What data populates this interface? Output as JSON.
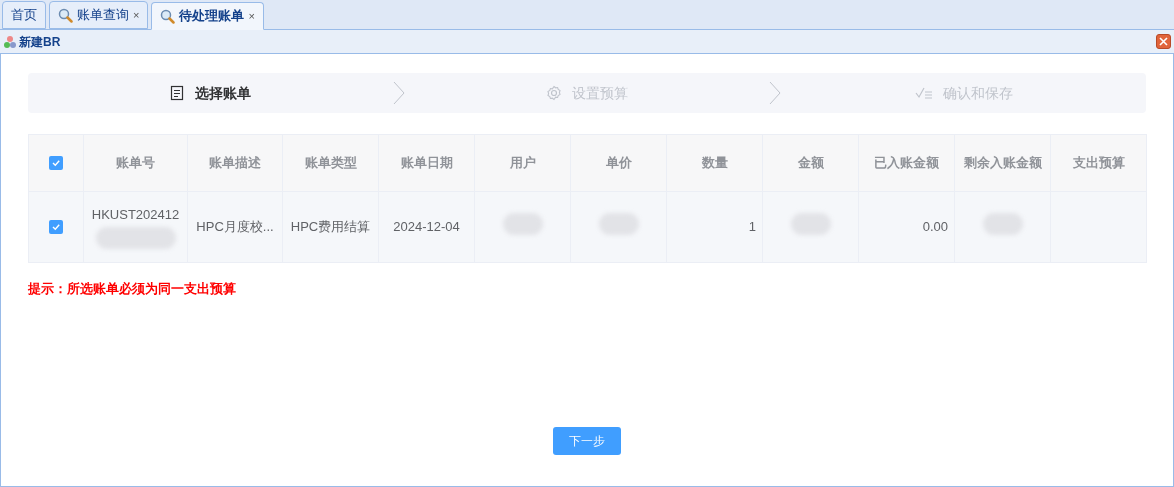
{
  "tabs": [
    {
      "label": "首页",
      "icon": false,
      "selected": false
    },
    {
      "label": "账单查询",
      "icon": true,
      "close": "×",
      "selected": false
    },
    {
      "label": "待处理账单",
      "icon": true,
      "close": "×",
      "selected": true
    }
  ],
  "panel": {
    "title": "新建BR"
  },
  "steps": [
    {
      "label": "选择账单",
      "kind": "document",
      "selected": true
    },
    {
      "label": "设置预算",
      "kind": "gear",
      "selected": false
    },
    {
      "label": "确认和保存",
      "kind": "checklist",
      "selected": false
    }
  ],
  "table": {
    "all_checked": true,
    "columns": [
      "账单号",
      "账单描述",
      "账单类型",
      "账单日期",
      "用户",
      "单价",
      "数量",
      "金额",
      "已入账金额",
      "剩余入账金额",
      "支出预算"
    ],
    "rows": [
      {
        "checked": true,
        "cells": [
          {
            "kind": "text_redacted",
            "text": "HKUST202412"
          },
          {
            "kind": "text",
            "text": "HPC月度校..."
          },
          {
            "kind": "text",
            "text": "HPC费用结算"
          },
          {
            "kind": "text",
            "text": "2024-12-04"
          },
          {
            "kind": "redacted"
          },
          {
            "kind": "redacted"
          },
          {
            "kind": "number",
            "text": "1"
          },
          {
            "kind": "redacted"
          },
          {
            "kind": "number",
            "text": "0.00"
          },
          {
            "kind": "redacted"
          },
          {
            "kind": "empty"
          }
        ]
      }
    ]
  },
  "hint": "提示：所选账单必须为同一支出预算",
  "next_button": "下一步"
}
